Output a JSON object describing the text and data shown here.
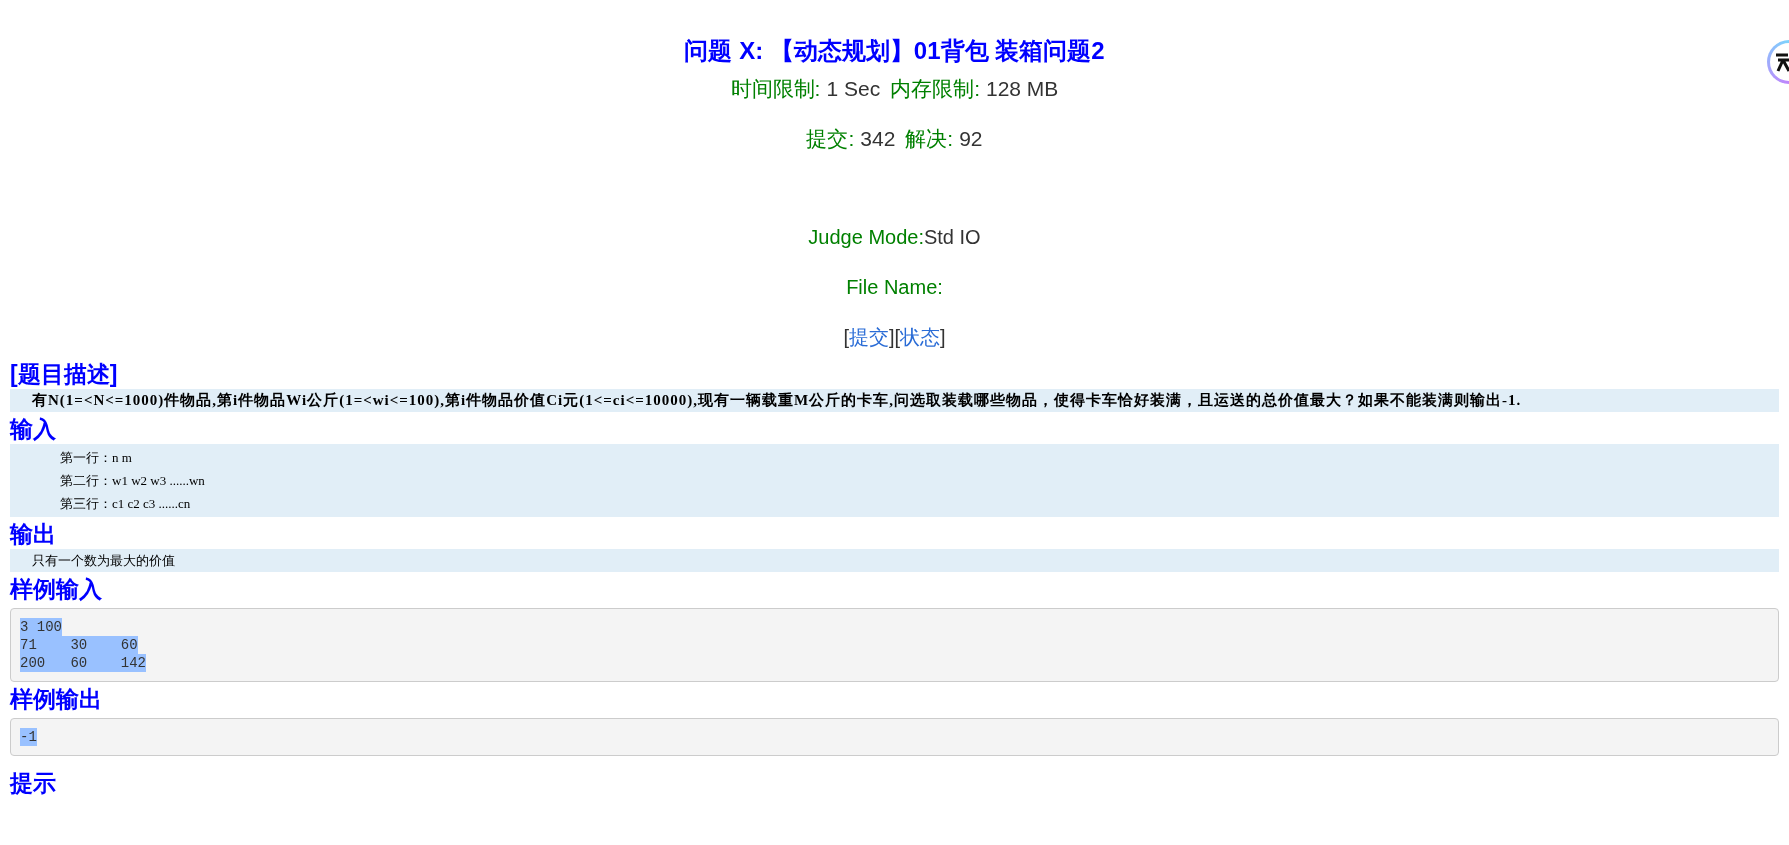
{
  "header": {
    "title": "问题 X: 【动态规划】01背包 装箱问题2",
    "limits": [
      {
        "label": "时间限制:",
        "value": "1 Sec"
      },
      {
        "label": "内存限制:",
        "value": "128 MB"
      }
    ],
    "stats": [
      {
        "label": "提交:",
        "value": "342"
      },
      {
        "label": "解决:",
        "value": "92"
      }
    ],
    "judge_mode": {
      "label": "Judge Mode:",
      "value": "Std IO"
    },
    "file_name": {
      "label": "File Name:"
    },
    "links": [
      {
        "open": "[",
        "label": "提交",
        "close": "]"
      },
      {
        "open": "[",
        "label": "状态",
        "close": "]"
      }
    ]
  },
  "sections": [
    {
      "kind": "text",
      "heading": "[题目描述]",
      "bold": true,
      "indent": false,
      "lines": [
        "有N(1=<N<=1000)件物品,第i件物品Wi公斤(1=<wi<=100),第i件物品价值Ci元(1<=ci<=10000),现有一辆载重M公斤的卡车,问选取装载哪些物品，使得卡车恰好装满，且运送的总价值最大？如果不能装满则输出-1."
      ]
    },
    {
      "kind": "text",
      "heading": "输入",
      "bold": false,
      "indent": true,
      "lines": [
        "第一行：n m",
        "第二行：w1 w2 w3 ......wn",
        "第三行：c1 c2 c3 ......cn"
      ]
    },
    {
      "kind": "text",
      "heading": "输出",
      "bold": false,
      "indent": false,
      "lines": [
        "只有一个数为最大的价值"
      ]
    },
    {
      "kind": "sample",
      "heading": "样例输入",
      "highlighted": true,
      "lines": [
        "3 100",
        "71    30    60",
        "200   60    142"
      ]
    },
    {
      "kind": "sample",
      "heading": "样例输出",
      "highlighted": true,
      "lines": [
        "-1"
      ]
    },
    {
      "kind": "heading",
      "heading": "提示"
    }
  ]
}
